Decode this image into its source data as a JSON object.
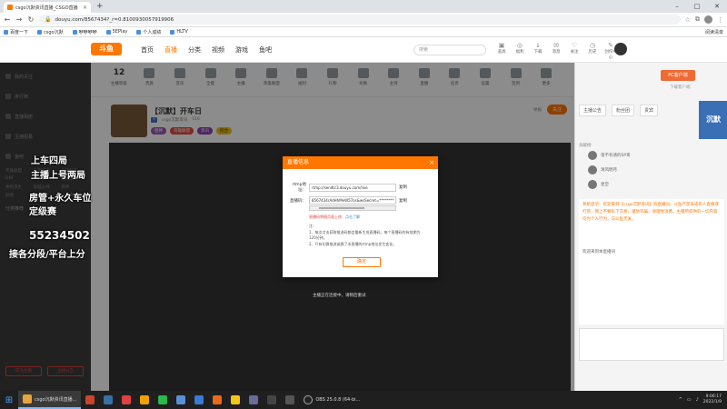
{
  "browser": {
    "tab_title": "csgo沉默资讯直播_CSGO直播",
    "url": "douyu.com/8567434?_r=0.8100930057919906",
    "bookmarks": [
      "百度一下",
      "csgo沉默",
      "咿咿咿咿",
      "5EPlay",
      "个人成绩",
      "HLTV"
    ],
    "bookmarks_right": "阅读清单"
  },
  "douyu": {
    "logo": "斗鱼",
    "nav": [
      "首页",
      "直播",
      "分类",
      "视频",
      "游戏",
      "鱼吧"
    ],
    "nav_active": "直播",
    "search_placeholder": "搜索",
    "top_icons": [
      "道具",
      "福利",
      "下载",
      "消息",
      "关注",
      "历史",
      "创作中心"
    ]
  },
  "categories": {
    "first_num": "12",
    "first_label": "主播等级",
    "items": [
      "贵族",
      "音乐",
      "全能",
      "主播",
      "英雄联盟",
      "福利",
      "礼物",
      "兑换",
      "主持",
      "直播",
      "任务",
      "设置",
      "签到",
      "更多"
    ]
  },
  "room": {
    "title": "【沉默】开车日",
    "tag": "7",
    "meta": "csgo沉默资讯",
    "count": "116",
    "tags": [
      "狙神",
      "英雄联盟",
      "资讯",
      "综合"
    ],
    "report": "举报",
    "follow": "关注"
  },
  "chat": {
    "pc_button": "PC客户端",
    "pc_tip": "下载客户端",
    "tabs": [
      "主播公告",
      "粉丝团",
      "贵宾"
    ],
    "brand": "沉默",
    "rank_header": "贡献榜",
    "rank_names": [
      "夜不有请的SP哥",
      "清风明月",
      "星空"
    ],
    "system_msg": "系统提示：欢迎来到【csgo沉默资讯】的直播间。斗鱼严禁未成年人直播或打赏，网上不要私下交易，谨防诈骗，请理性消费。主播所提供的一切内容均为个人行为，与斗鱼无关。",
    "welcome": "欢迎来到本直播间"
  },
  "sidebar": {
    "items": [
      "我的关注",
      "排行榜",
      "直播相册",
      "主播招募",
      "鱼吧"
    ],
    "grid": [
      "英雄联盟",
      "王者荣耀",
      "和平精英",
      "DNF",
      "CSGO",
      "主机游戏",
      "绝地求生",
      "穿越火线",
      "原神",
      "颜值",
      "户外",
      "一起看"
    ],
    "section": "分类推荐",
    "btn_left": "成为主播",
    "btn_right": "主播公告"
  },
  "overlay": {
    "line1": "上车四局",
    "line2": "主播上号两局",
    "line3": "房管+永久车位",
    "line4": "定级赛",
    "line5": "55234502",
    "line6": "接各分段/平台上分"
  },
  "dialog": {
    "title": "直播信息",
    "close": "×",
    "rtmp_label": "rtmp地址：",
    "rtmp_value": "rtmp://sendtc3.douyu.com/live",
    "code_label": "直播码：",
    "code_value": "8567434rAdHhMeW57os&wsSecret=********",
    "copy": "复制",
    "warn": "直播码将随页面上线",
    "warn_link": "点击了解",
    "note_title": "注：",
    "note1": "1、每次点击获取推流码都会重新生成直播码，每个直播码的有效期为120分钟。",
    "note2": "2、只有切换推流或换了本直播的rtmp地址发生变化。",
    "ok": "确定"
  },
  "below_dialog": "主播正在连接中，请稍后重试",
  "taskbar": {
    "chrome_label": "csgo沉默资讯直播...",
    "obs_label": "OBS 25.0.8 (64-bi...",
    "time": "9:06:17",
    "date": "2022/1/9"
  },
  "colors": {
    "brand_orange": "#ff7700",
    "dialog_header": "#ff7700",
    "taskbar": "#1f1f1f"
  }
}
